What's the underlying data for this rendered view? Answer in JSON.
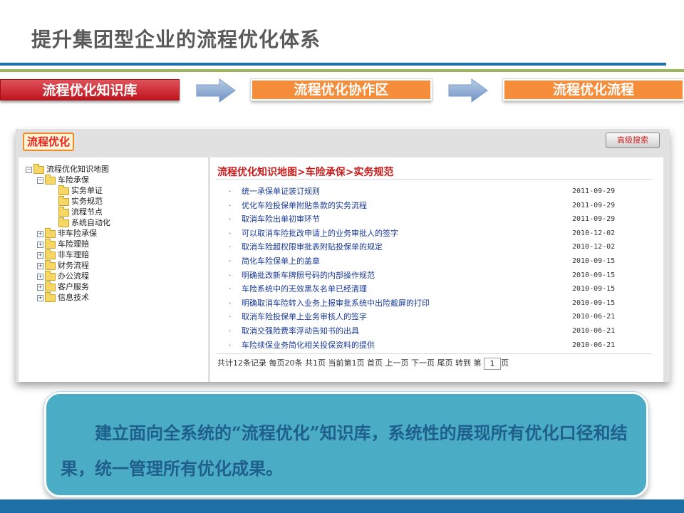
{
  "title": "提升集团型企业的流程优化体系",
  "steps": [
    "流程优化知识库",
    "流程优化协作区",
    "流程优化流程"
  ],
  "colors": {
    "accent_red": "#c0151e",
    "accent_orange": "#f68d3a",
    "blue_rule": "#1f6fa8",
    "green_rule": "#9aba59",
    "callout_bg": "#4bacc6"
  },
  "panel": {
    "logo": "流程优化",
    "advanced_search": "高级搜索",
    "tree": {
      "root": "流程优化知识地图",
      "level1": [
        "车险承保",
        "非车险承保",
        "车险理赔",
        "非车理赔",
        "财务流程",
        "办公流程",
        "客户服务",
        "信息技术"
      ],
      "level2": [
        "实务单证",
        "实务规范",
        "流程节点",
        "系统自动化"
      ]
    },
    "breadcrumb": "流程优化知识地图>车险承保>实务规范",
    "bullet": "·",
    "items": [
      {
        "title": "统一承保单证装订规则",
        "date": "2011-09-29"
      },
      {
        "title": "优化车险投保单附贴条款的实务流程",
        "date": "2011-09-29"
      },
      {
        "title": "取消车险出单初审环节",
        "date": "2011-09-29"
      },
      {
        "title": "可以取消车险批改申请上的业务审批人的签字",
        "date": "2010-12-02"
      },
      {
        "title": "取消车险超权限审批表附贴投保单的规定",
        "date": "2010-12-02"
      },
      {
        "title": "简化车险保单上的盖章",
        "date": "2010-09-15"
      },
      {
        "title": "明确批改新车牌照号码的内部操作规范",
        "date": "2010-09-15"
      },
      {
        "title": "车险系统中的无效黑灰名单已经清理",
        "date": "2010-09-15"
      },
      {
        "title": "明确取消车险转入业务上报审批系统中出险截屏的打印",
        "date": "2010-09-15"
      },
      {
        "title": "取消车险投保单上业务审核人的签字",
        "date": "2010-06-21"
      },
      {
        "title": "取消交强险费率浮动告知书的出具",
        "date": "2010-06-21"
      },
      {
        "title": "车险续保业务简化相关投保资料的提供",
        "date": "2010-06-21"
      }
    ],
    "pager": {
      "total": "共计12条记录",
      "per_page": "每页20条",
      "pages": "共1页",
      "current": "当前第1页",
      "first": "首页",
      "prev": "上一页",
      "next": "下一页",
      "last": "尾页",
      "goto": "转到 第",
      "page_value": "1",
      "page_suffix": "页"
    }
  },
  "callout": "建立面向全系统的“流程优化”知识库，系统性的展现所有优化口径和结果，统一管理所有优化成果。"
}
